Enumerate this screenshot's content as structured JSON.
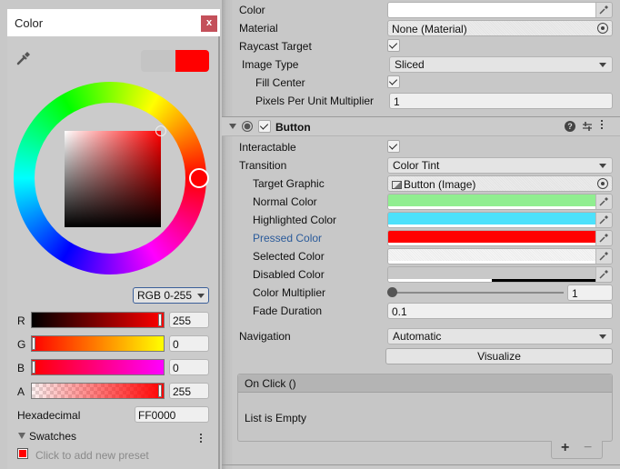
{
  "color_window": {
    "title": "Color",
    "close_label": "x",
    "icons": {
      "eyedropper": "eyedropper-icon",
      "close": "close-icon"
    },
    "previous_color": "#c4c4c4",
    "current_color": "#ff0000",
    "mode": "RGB 0-255",
    "channels": [
      {
        "label": "R",
        "value": "255",
        "fraction": 1.0
      },
      {
        "label": "G",
        "value": "0",
        "fraction": 0.0
      },
      {
        "label": "B",
        "value": "0",
        "fraction": 0.0
      },
      {
        "label": "A",
        "value": "255",
        "fraction": 1.0
      }
    ],
    "hex_label": "Hexadecimal",
    "hex_value": "FF0000",
    "swatches_label": "Swatches",
    "add_preset_label": "Click to add new preset",
    "preset_color": "#ff0000"
  },
  "inspector": {
    "image": {
      "color_label": "Color",
      "color_value": "#ffffff",
      "material_label": "Material",
      "material_value": "None (Material)",
      "raycast_label": "Raycast Target",
      "raycast_checked": true,
      "image_type_label": "Image Type",
      "image_type_value": "Sliced",
      "fill_center_label": "Fill Center",
      "fill_center_checked": true,
      "ppu_label": "Pixels Per Unit Multiplier",
      "ppu_value": "1"
    },
    "button": {
      "title": "Button",
      "enabled": true,
      "help_glyph": "?",
      "interactable_label": "Interactable",
      "interactable_checked": true,
      "transition_label": "Transition",
      "transition_value": "Color Tint",
      "target_graphic_label": "Target Graphic",
      "target_graphic_value": "Button (Image)",
      "colors": [
        {
          "label": "Normal Color",
          "color": "#90ee90"
        },
        {
          "label": "Highlighted Color",
          "color": "#4de1fb"
        },
        {
          "label": "Pressed Color",
          "color": "#ff0000"
        },
        {
          "label": "Selected Color",
          "color": "#f5f5f5"
        },
        {
          "label": "Disabled Color",
          "color": "#c8c8c8",
          "alpha": 0.5
        }
      ],
      "color_multiplier_label": "Color Multiplier",
      "color_multiplier_value": "1",
      "fade_duration_label": "Fade Duration",
      "fade_duration_value": "0.1",
      "navigation_label": "Navigation",
      "navigation_value": "Automatic",
      "visualize_label": "Visualize",
      "on_click_label": "On Click ()",
      "list_empty_label": "List is Empty",
      "add_label": "+",
      "remove_label": "−"
    }
  }
}
